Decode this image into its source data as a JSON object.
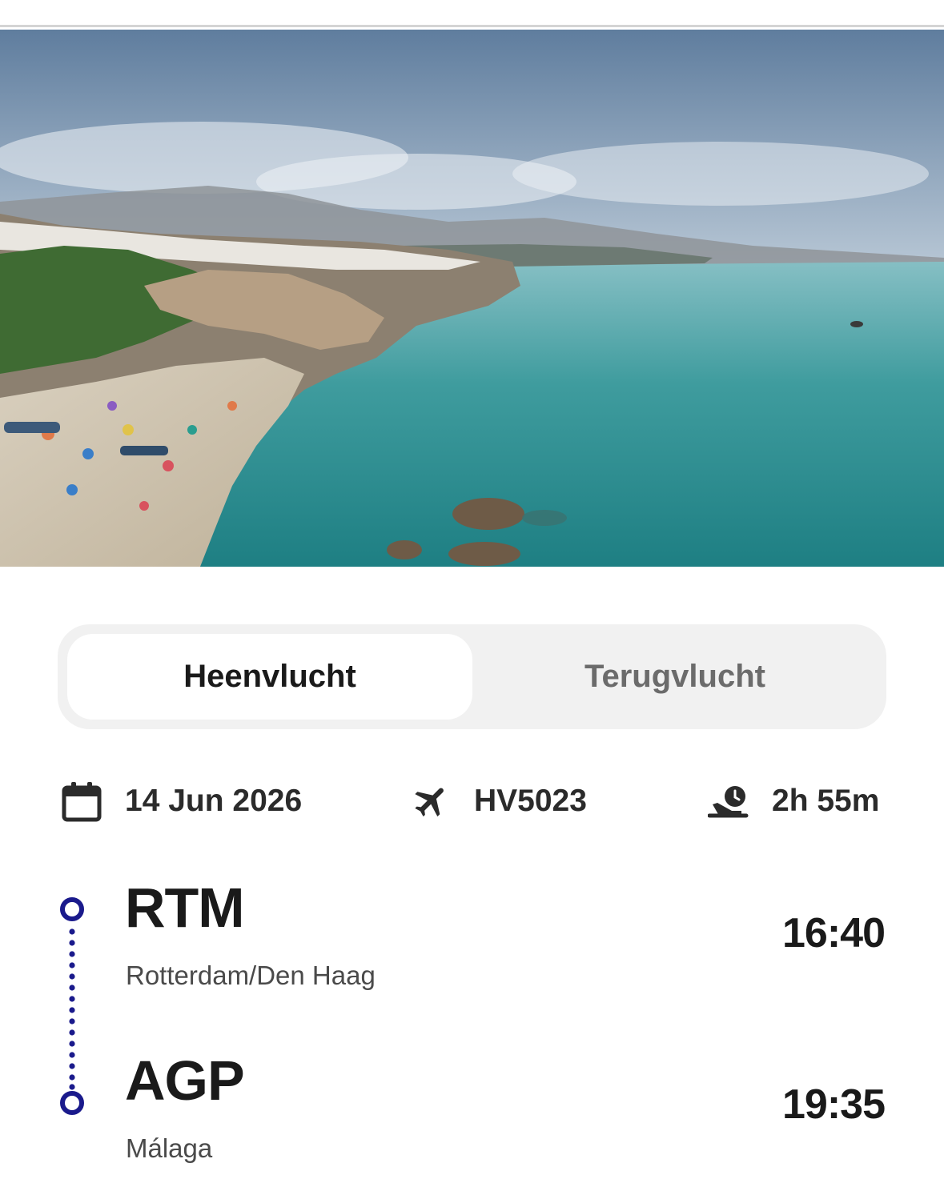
{
  "hero": {
    "image": "coastal-beach-photo"
  },
  "tabs": [
    {
      "label": "Heenvlucht",
      "active": true
    },
    {
      "label": "Terugvlucht",
      "active": false
    }
  ],
  "meta": {
    "date": "14 Jun 2026",
    "flight_number": "HV5023",
    "duration": "2h 55m",
    "icons": {
      "date": "calendar-icon",
      "flight": "airplane-icon",
      "duration": "flight-duration-icon"
    }
  },
  "route": {
    "origin": {
      "code": "RTM",
      "city": "Rotterdam/Den Haag",
      "time": "16:40"
    },
    "destination": {
      "code": "AGP",
      "city": "Málaga",
      "time": "19:35"
    }
  },
  "colors": {
    "timeline": "#1a1a8c",
    "tab_bg": "#f1f1f1",
    "tab_active_bg": "#ffffff",
    "tab_inactive_text": "#6b6b6b"
  }
}
